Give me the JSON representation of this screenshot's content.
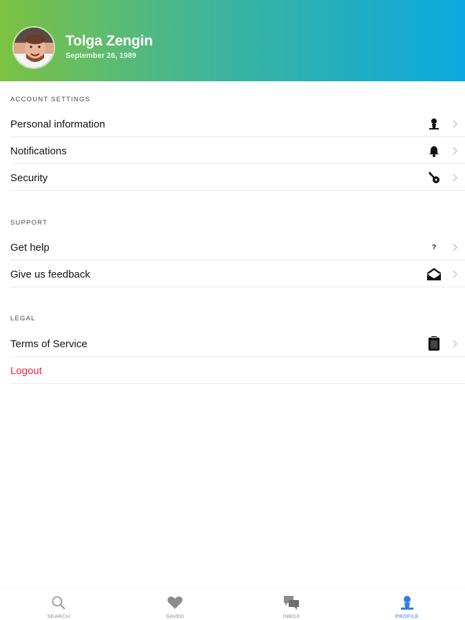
{
  "header": {
    "name": "Tolga Zengin",
    "birthdate": "September 26, 1989",
    "gradient": [
      "#7dc242",
      "#0aa9e0"
    ]
  },
  "sections": {
    "account": {
      "title": "ACCOUNT SETTINGS",
      "items": [
        {
          "label": "Personal information",
          "icon": "person-icon"
        },
        {
          "label": "Notifications",
          "icon": "bell-icon"
        },
        {
          "label": "Security",
          "icon": "key-icon"
        }
      ]
    },
    "support": {
      "title": "SUPPORT",
      "items": [
        {
          "label": "Get help",
          "icon": "question-icon",
          "icon_text": "?"
        },
        {
          "label": "Give us feedback",
          "icon": "envelope-icon"
        }
      ]
    },
    "legal": {
      "title": "LEGAL",
      "items": [
        {
          "label": "Terms of Service",
          "icon": "clipboard-icon"
        }
      ]
    },
    "logout": {
      "label": "Logout",
      "color": "#f0243a"
    }
  },
  "tabbar": {
    "tabs": [
      {
        "label": "SEARCH",
        "icon": "search-icon",
        "active": false
      },
      {
        "label": "SAVED",
        "icon": "heart-icon",
        "active": false
      },
      {
        "label": "INBOX",
        "icon": "chat-icon",
        "active": false
      },
      {
        "label": "PROFILE",
        "icon": "person-icon",
        "active": true
      }
    ],
    "active_color": "#2c7de8",
    "inactive_color": "#8c8c8c"
  }
}
